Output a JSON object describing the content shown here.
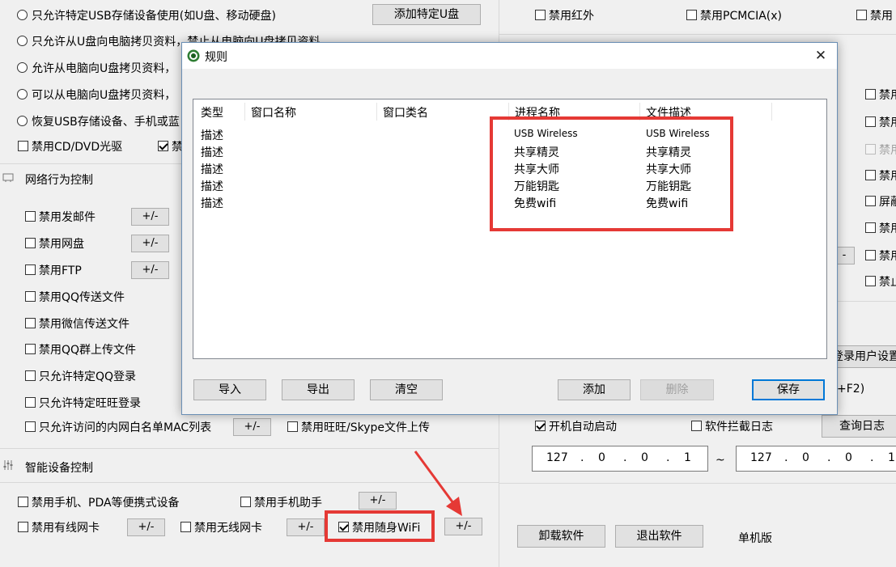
{
  "left_panel": {
    "usb_options": [
      "只允许特定USB存储设备使用(如U盘、移动硬盘)",
      "只允许从U盘向电脑拷贝资料，禁止从电脑向U盘拷贝资料",
      "允许从电脑向U盘拷贝资料，",
      "可以从电脑向U盘拷贝资料，",
      "恢复USB存储设备、手机或蓝"
    ],
    "add_usb_button": "添加特定U盘",
    "disable_cd": "禁用CD/DVD光驱",
    "disable_truncated": "禁",
    "network_section_title": "网络行为控制",
    "network_items": {
      "email": "禁用发邮件",
      "netdisk": "禁用网盘",
      "ftp": "禁用FTP",
      "qq_file": "禁用QQ传送文件",
      "wechat_file": "禁用微信传送文件",
      "qq_group": "禁用QQ群上传文件",
      "qq_login": "只允许特定QQ登录",
      "wangwang_login": "只允许特定旺旺登录",
      "mac_whitelist": "只允许访问的内网白名单MAC列表",
      "wangwang_skype": "禁用旺旺/Skype文件上传"
    },
    "plus_minus": "+/-",
    "smart_section_title": "智能设备控制",
    "smart_items": {
      "mobile": "禁用手机、PDA等便携式设备",
      "phone_assistant": "禁用手机助手",
      "wired_nic": "禁用有线网卡",
      "wireless_nic": "禁用无线网卡",
      "portable_wifi": "禁用随身WiFi"
    }
  },
  "right_panel": {
    "disable_infrared": "禁用红外",
    "disable_pcmcia": "禁用PCMCIA(x)",
    "disable_truncated": "禁用",
    "truncated_items": [
      "禁用",
      "禁用",
      "禁用",
      "禁用",
      "屏蔽",
      "禁用",
      "禁用",
      "禁止"
    ],
    "partial_button": "-",
    "login_user_settings": "登录用户设置",
    "hotkey_hint": "+F2)",
    "autostart": "开机自动启动",
    "intercept_log": "软件拦截日志",
    "query_log_button": "查询日志",
    "ip_from": [
      "127",
      ".",
      "0",
      ".",
      "0",
      ".",
      "1"
    ],
    "ip_tilde": "~",
    "ip_to": [
      "127",
      ".",
      "0",
      ".",
      "0",
      ".",
      "1"
    ],
    "uninstall_button": "卸载软件",
    "exit_button": "退出软件",
    "standalone_label": "单机版"
  },
  "dialog": {
    "title": "规则",
    "close_glyph": "✕",
    "columns": [
      "类型",
      "窗口名称",
      "窗口类名",
      "进程名称",
      "文件描述"
    ],
    "rows": [
      {
        "type": "描述",
        "process": "USB Wireless",
        "description": "USB Wireless"
      },
      {
        "type": "描述",
        "process": "共享精灵",
        "description": "共享精灵"
      },
      {
        "type": "描述",
        "process": "共享大师",
        "description": "共享大师"
      },
      {
        "type": "描述",
        "process": "万能钥匙",
        "description": "万能钥匙"
      },
      {
        "type": "描述",
        "process": "免费wifi",
        "description": "免费wifi"
      }
    ],
    "buttons": {
      "import": "导入",
      "export": "导出",
      "clear": "清空",
      "add": "添加",
      "delete": "删除",
      "save": "保存"
    }
  },
  "colors": {
    "annotation_red": "#e53935",
    "dialog_border": "#6a8fb5",
    "save_focus": "#0078d7"
  }
}
